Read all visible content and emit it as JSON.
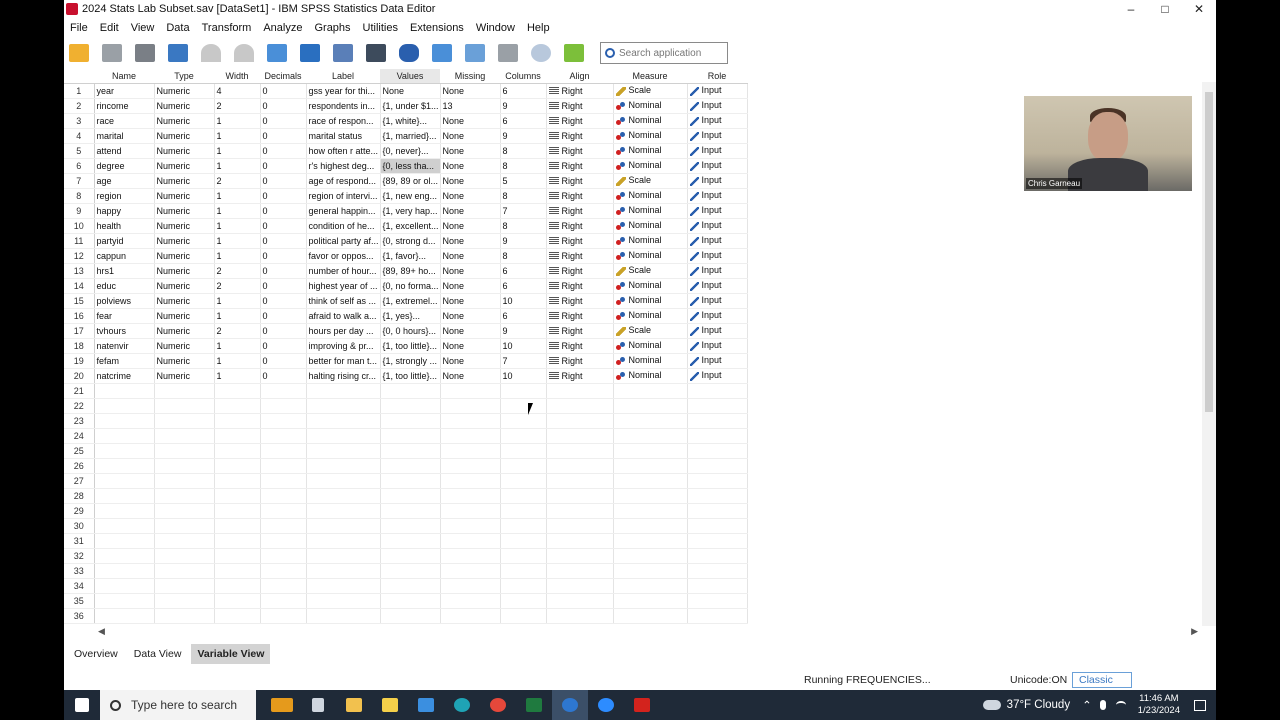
{
  "window": {
    "title": "2024 Stats Lab Subset.sav [DataSet1] - IBM SPSS Statistics Data Editor",
    "minimize": "–",
    "maximize": "□",
    "close": "✕"
  },
  "menu": [
    "File",
    "Edit",
    "View",
    "Data",
    "Transform",
    "Analyze",
    "Graphs",
    "Utilities",
    "Extensions",
    "Window",
    "Help"
  ],
  "toolbar": {
    "search_placeholder": "Search application"
  },
  "grid": {
    "columns": [
      "Name",
      "Type",
      "Width",
      "Decimals",
      "Label",
      "Values",
      "Missing",
      "Columns",
      "Align",
      "Measure",
      "Role"
    ],
    "selected_column": "Values",
    "rows": [
      [
        "1",
        "year",
        "Numeric",
        "4",
        "0",
        "gss year for thi...",
        "None",
        "None",
        "6",
        "Right",
        "Scale",
        "Input"
      ],
      [
        "2",
        "rincome",
        "Numeric",
        "2",
        "0",
        "respondents in...",
        "{1, under $1...",
        "13",
        "9",
        "Right",
        "Nominal",
        "Input"
      ],
      [
        "3",
        "race",
        "Numeric",
        "1",
        "0",
        "race of respon...",
        "{1, white}...",
        "None",
        "6",
        "Right",
        "Nominal",
        "Input"
      ],
      [
        "4",
        "marital",
        "Numeric",
        "1",
        "0",
        "marital status",
        "{1, married}...",
        "None",
        "9",
        "Right",
        "Nominal",
        "Input"
      ],
      [
        "5",
        "attend",
        "Numeric",
        "1",
        "0",
        "how often r atte...",
        "{0, never}...",
        "None",
        "8",
        "Right",
        "Nominal",
        "Input"
      ],
      [
        "6",
        "degree",
        "Numeric",
        "1",
        "0",
        "r's highest deg...",
        "{0, less tha...",
        "None",
        "8",
        "Right",
        "Nominal",
        "Input"
      ],
      [
        "7",
        "age",
        "Numeric",
        "2",
        "0",
        "age of respond...",
        "{89, 89 or ol...",
        "None",
        "5",
        "Right",
        "Scale",
        "Input"
      ],
      [
        "8",
        "region",
        "Numeric",
        "1",
        "0",
        "region of intervi...",
        "{1, new eng...",
        "None",
        "8",
        "Right",
        "Nominal",
        "Input"
      ],
      [
        "9",
        "happy",
        "Numeric",
        "1",
        "0",
        "general happin...",
        "{1, very hap...",
        "None",
        "7",
        "Right",
        "Nominal",
        "Input"
      ],
      [
        "10",
        "health",
        "Numeric",
        "1",
        "0",
        "condition of he...",
        "{1, excellent...",
        "None",
        "8",
        "Right",
        "Nominal",
        "Input"
      ],
      [
        "11",
        "partyid",
        "Numeric",
        "1",
        "0",
        "political party af...",
        "{0, strong d...",
        "None",
        "9",
        "Right",
        "Nominal",
        "Input"
      ],
      [
        "12",
        "cappun",
        "Numeric",
        "1",
        "0",
        "favor or oppos...",
        "{1, favor}...",
        "None",
        "8",
        "Right",
        "Nominal",
        "Input"
      ],
      [
        "13",
        "hrs1",
        "Numeric",
        "2",
        "0",
        "number of hour...",
        "{89, 89+ ho...",
        "None",
        "6",
        "Right",
        "Scale",
        "Input"
      ],
      [
        "14",
        "educ",
        "Numeric",
        "2",
        "0",
        "highest year of ...",
        "{0, no forma...",
        "None",
        "6",
        "Right",
        "Nominal",
        "Input"
      ],
      [
        "15",
        "polviews",
        "Numeric",
        "1",
        "0",
        "think of self as ...",
        "{1, extremel...",
        "None",
        "10",
        "Right",
        "Nominal",
        "Input"
      ],
      [
        "16",
        "fear",
        "Numeric",
        "1",
        "0",
        "afraid to walk a...",
        "{1, yes}...",
        "None",
        "6",
        "Right",
        "Nominal",
        "Input"
      ],
      [
        "17",
        "tvhours",
        "Numeric",
        "2",
        "0",
        "hours per day ...",
        "{0, 0 hours}...",
        "None",
        "9",
        "Right",
        "Scale",
        "Input"
      ],
      [
        "18",
        "natenvir",
        "Numeric",
        "1",
        "0",
        "improving & pr...",
        "{1, too little}...",
        "None",
        "10",
        "Right",
        "Nominal",
        "Input"
      ],
      [
        "19",
        "fefam",
        "Numeric",
        "1",
        "0",
        "better for man t...",
        "{1, strongly ...",
        "None",
        "7",
        "Right",
        "Nominal",
        "Input"
      ],
      [
        "20",
        "natcrime",
        "Numeric",
        "1",
        "0",
        "halting rising cr...",
        "{1, too little}...",
        "None",
        "10",
        "Right",
        "Nominal",
        "Input"
      ]
    ],
    "empty_rows": [
      "21",
      "22",
      "23",
      "24",
      "25",
      "26",
      "27",
      "28",
      "29",
      "30",
      "31",
      "32",
      "33",
      "34",
      "35",
      "36"
    ]
  },
  "tabs": [
    "Overview",
    "Data View",
    "Variable View"
  ],
  "active_tab": "Variable View",
  "status": {
    "running": "Running FREQUENCIES...",
    "unicode": "Unicode:ON",
    "classic": "Classic"
  },
  "webcam": {
    "name": "Chris Garneau"
  },
  "taskbar": {
    "search_placeholder": "Type here to search",
    "weather": "37°F  Cloudy",
    "time": "11:46 AM",
    "date": "1/23/2024"
  },
  "colors": {
    "taskbar": "#1f2a38",
    "selected_tab": "#d3d3d3",
    "accent_blue": "#2a5fae"
  }
}
